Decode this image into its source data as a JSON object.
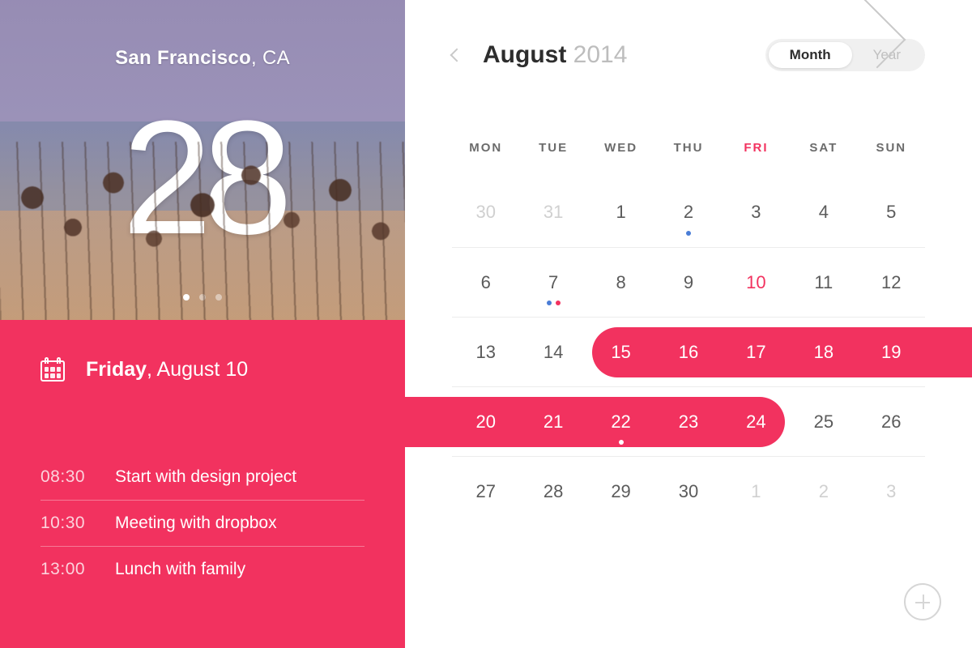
{
  "location": {
    "city": "San Francisco",
    "region": ", CA"
  },
  "weather": {
    "temperature": "28"
  },
  "pager": {
    "count": 3,
    "active_index": 0
  },
  "agenda": {
    "day_of_week": "Friday",
    "date_rest": ", August 10",
    "events": [
      {
        "time": "08:30",
        "title": "Start with design project"
      },
      {
        "time": "10:30",
        "title": "Meeting with dropbox"
      },
      {
        "time": "13:00",
        "title": "Lunch with family"
      }
    ]
  },
  "calendar": {
    "month": "August",
    "year": "2014",
    "view_toggle": {
      "month": "Month",
      "year": "Year",
      "active": "month"
    },
    "day_headers": [
      "MON",
      "TUE",
      "WED",
      "THU",
      "FRI",
      "SAT",
      "SUN"
    ],
    "today_col_index": 4,
    "weeks": [
      [
        {
          "n": "30",
          "muted": true
        },
        {
          "n": "31",
          "muted": true
        },
        {
          "n": "1"
        },
        {
          "n": "2",
          "dots": [
            "blue"
          ]
        },
        {
          "n": "3"
        },
        {
          "n": "4"
        },
        {
          "n": "5"
        }
      ],
      [
        {
          "n": "6"
        },
        {
          "n": "7",
          "dots": [
            "blue",
            "pink"
          ]
        },
        {
          "n": "8"
        },
        {
          "n": "9"
        },
        {
          "n": "10",
          "today": true
        },
        {
          "n": "11"
        },
        {
          "n": "12"
        }
      ],
      [
        {
          "n": "13"
        },
        {
          "n": "14"
        },
        {
          "n": "15",
          "range": true
        },
        {
          "n": "16",
          "range": true
        },
        {
          "n": "17",
          "range": true
        },
        {
          "n": "18",
          "range": true
        },
        {
          "n": "19",
          "range": true
        }
      ],
      [
        {
          "n": "20",
          "range": true
        },
        {
          "n": "21",
          "range": true
        },
        {
          "n": "22",
          "range": true,
          "dots": [
            "white"
          ]
        },
        {
          "n": "23",
          "range": true
        },
        {
          "n": "24",
          "range": true
        },
        {
          "n": "25"
        },
        {
          "n": "26"
        }
      ],
      [
        {
          "n": "27"
        },
        {
          "n": "28"
        },
        {
          "n": "29"
        },
        {
          "n": "30"
        },
        {
          "n": "1",
          "muted": true
        },
        {
          "n": "2",
          "muted": true
        },
        {
          "n": "3",
          "muted": true
        }
      ]
    ]
  },
  "colors": {
    "accent": "#f2325f",
    "blue": "#4a7dd6"
  }
}
